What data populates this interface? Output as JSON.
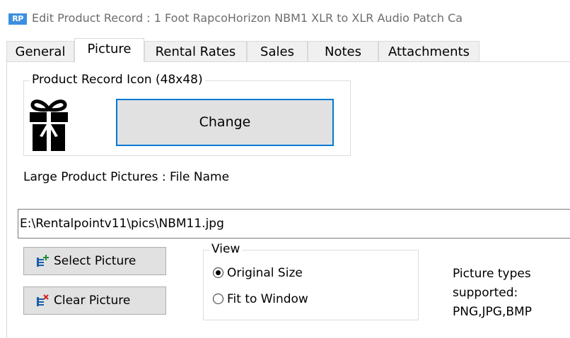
{
  "window": {
    "app_icon_text": "RP",
    "title": "Edit Product Record : 1 Foot RapcoHorizon NBM1 XLR to XLR Audio Patch Ca"
  },
  "tabs": [
    {
      "label": "General"
    },
    {
      "label": "Picture"
    },
    {
      "label": "Rental Rates"
    },
    {
      "label": "Sales"
    },
    {
      "label": "Notes"
    },
    {
      "label": "Attachments"
    }
  ],
  "active_tab": "Picture",
  "icon_group": {
    "legend": "Product Record Icon (48x48)",
    "icon": "gift-icon",
    "change_label": "Change"
  },
  "large_pictures": {
    "label": "Large Product Pictures : File Name",
    "file_name": "E:\\Rentalpointv11\\pics\\NBM11.jpg",
    "select_label": "Select Picture",
    "clear_label": "Clear Picture"
  },
  "view": {
    "legend": "View",
    "options": [
      {
        "label": "Original Size",
        "selected": true
      },
      {
        "label": "Fit to Window",
        "selected": false
      }
    ]
  },
  "supported_types": {
    "line1": "Picture types",
    "line2": "supported:",
    "line3": "PNG,JPG,BMP"
  },
  "colors": {
    "focus_border": "#0078d7",
    "button_face": "#e1e1e1",
    "app_icon_bg": "#3b8fe0"
  }
}
